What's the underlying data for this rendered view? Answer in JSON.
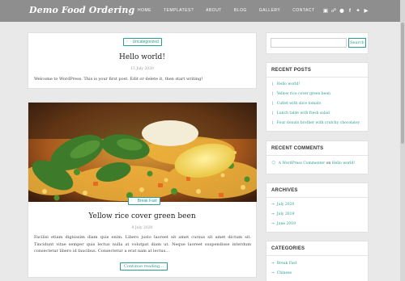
{
  "header": {
    "brand": "Demo Food Ordering",
    "nav": [
      "HOME",
      "TEMPLATES?",
      "ABOUT",
      "BLOG",
      "GALLERY",
      "CONTACT"
    ],
    "icons": [
      "bag-icon",
      "cart-icon",
      "user-icon",
      "facebook-icon",
      "twitter-icon",
      "youtube-icon"
    ]
  },
  "post1": {
    "category": "Uncategorized",
    "title": "Hello world!",
    "date": "15 July 2020",
    "excerpt": "Welcome to WordPress. This is your first post. Edit or delete it, then start writing!"
  },
  "post2": {
    "category": "Break Fast",
    "title": "Yellow rice cover green been",
    "date": "9 July 2020",
    "excerpt": "Facilisi etiam dignissim diam quis enim. Libero justo laoreet sit amet cursus sit amet dictum sit. Tincidunt vitae semper quis lectus nulla at volutpat diam ut. Neque laoreet suspendisse interdum consectetur libero id faucibus. Consectetur a erat nam at lectus...",
    "more": "Continue reading..."
  },
  "sidebar": {
    "search_button": "Search",
    "recent_posts": {
      "title": "RECENT POSTS",
      "items": [
        "Hello world!",
        "Yellow rice cover green been",
        "Cutlet with slice tomato",
        "Lunch table with fresh salad",
        "Four donuts brother with crutchy chocolatey"
      ]
    },
    "recent_comments": {
      "title": "RECENT COMMENTS",
      "author": "A WordPress Commenter",
      "on": "on",
      "post": "Hello world!"
    },
    "archives": {
      "title": "ARCHIVES",
      "items": [
        "July 2020",
        "July 2019",
        "June 2019"
      ]
    },
    "categories": {
      "title": "CATEGORIES",
      "items": [
        "Break Fast",
        "Chinese"
      ]
    }
  },
  "colors": {
    "accent": "#2a9d8f",
    "header": "#8e8e8e",
    "background": "#e9e9e9"
  }
}
